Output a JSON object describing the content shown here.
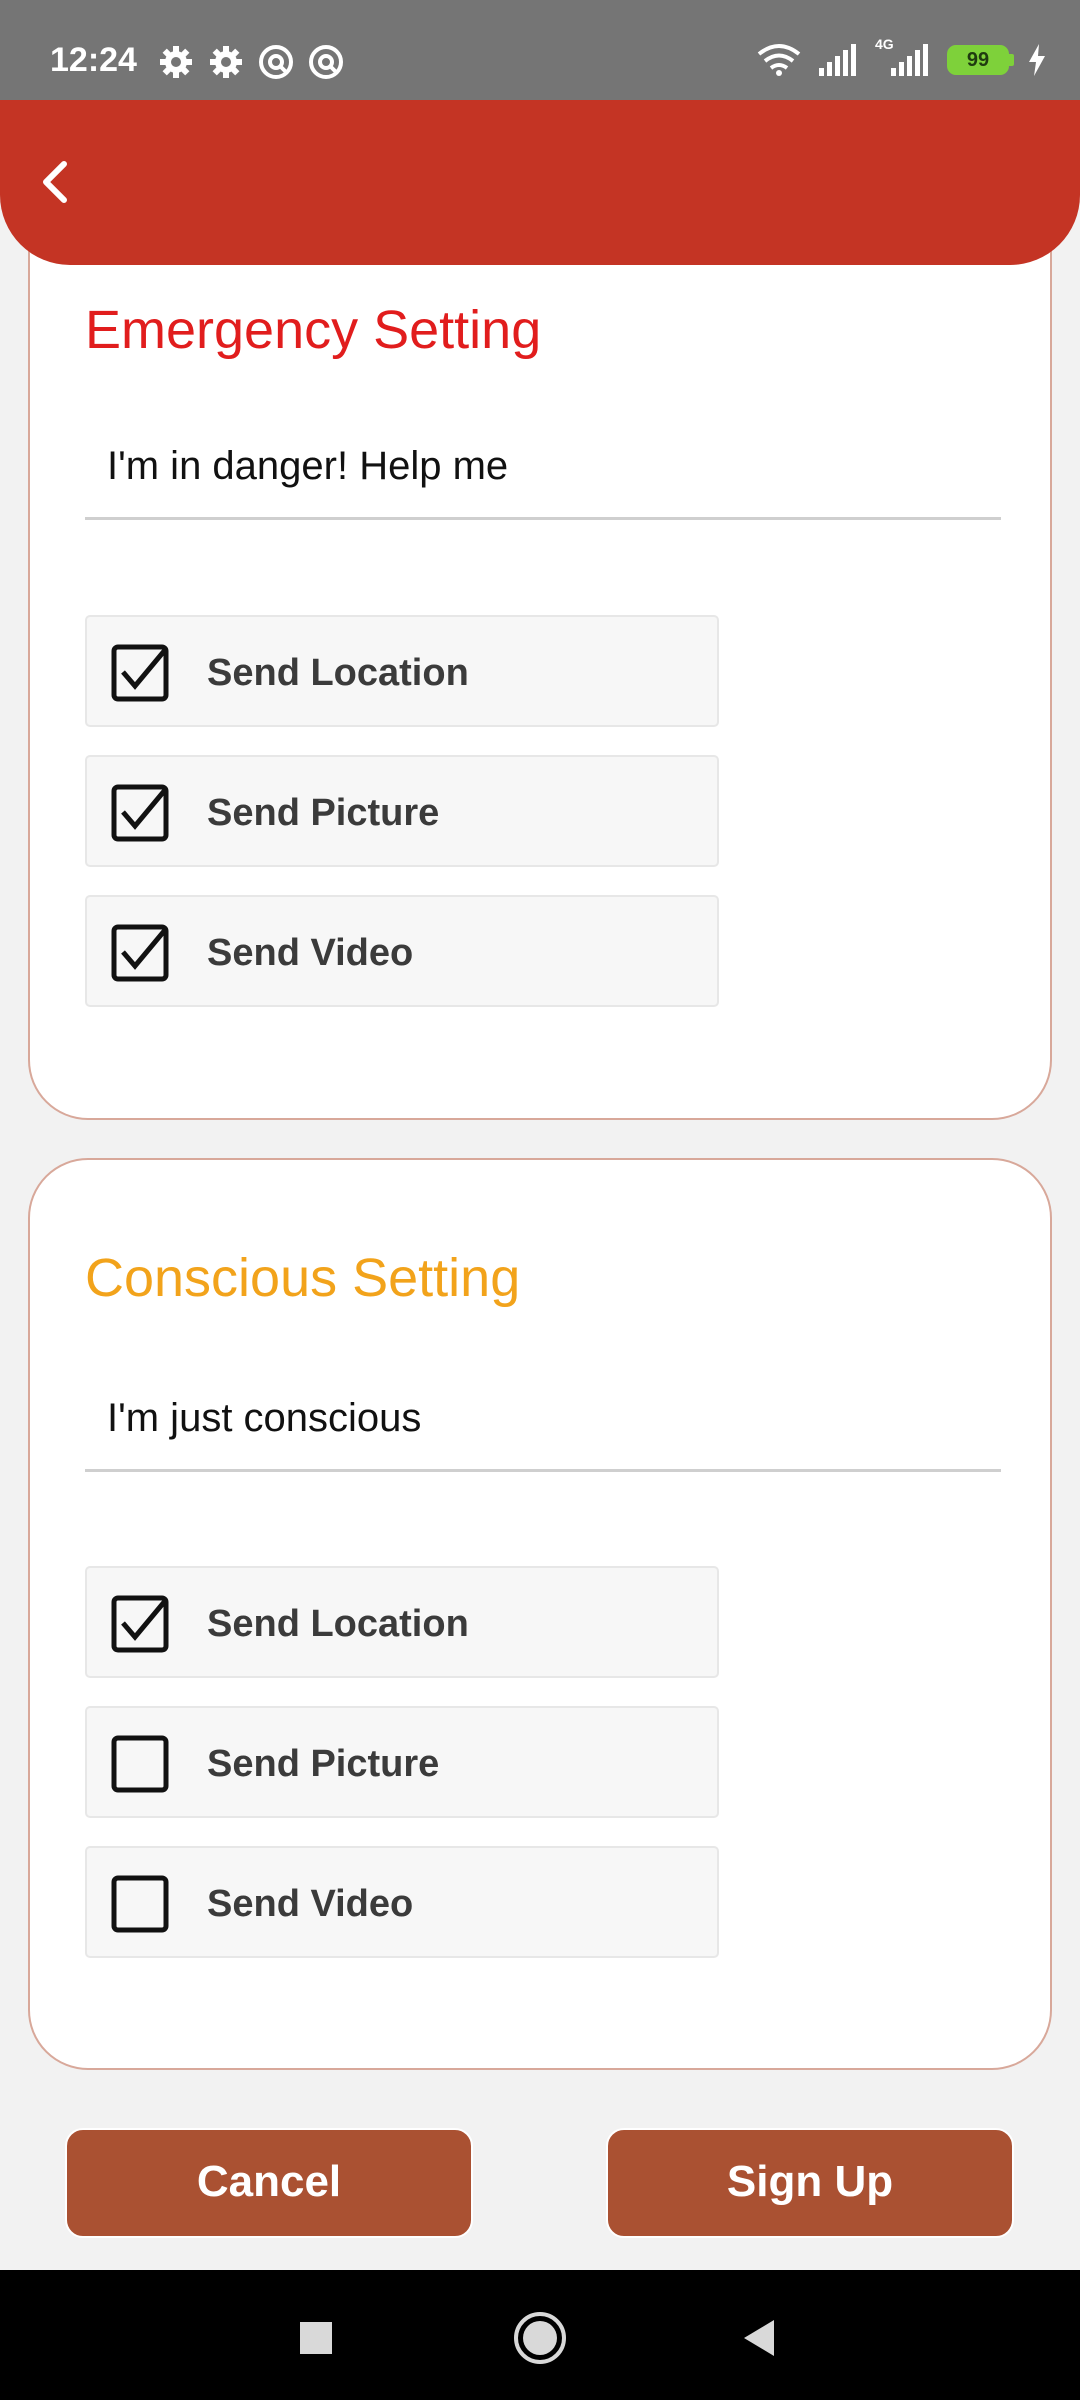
{
  "status_bar": {
    "time": "12:24",
    "battery": "99",
    "network": "4G",
    "left_icons": [
      "gear-icon",
      "gear-icon",
      "at-sign-icon",
      "at-sign-icon"
    ],
    "right_icons": [
      "wifi-icon",
      "signal-icon",
      "signal-4g-icon",
      "battery-icon",
      "charging-bolt-icon"
    ]
  },
  "header": {
    "back_icon": "chevron-left-icon",
    "accent_color": "#c43424"
  },
  "emergency": {
    "title": "Emergency Setting",
    "title_color": "#e11d1d",
    "message": "I'm in danger! Help me",
    "options": [
      {
        "label": "Send Location",
        "checked": true
      },
      {
        "label": "Send Picture",
        "checked": true
      },
      {
        "label": "Send Video",
        "checked": true
      }
    ]
  },
  "conscious": {
    "title": "Conscious Setting",
    "title_color": "#f2a31b",
    "message": "I'm just conscious",
    "options": [
      {
        "label": "Send Location",
        "checked": true
      },
      {
        "label": "Send Picture",
        "checked": false
      },
      {
        "label": "Send Video",
        "checked": false
      }
    ]
  },
  "actions": {
    "cancel_label": "Cancel",
    "signup_label": "Sign Up",
    "button_color": "#aa5132"
  },
  "nav_bar": {
    "icons": [
      "square-recents-icon",
      "circle-home-icon",
      "triangle-back-icon"
    ]
  }
}
